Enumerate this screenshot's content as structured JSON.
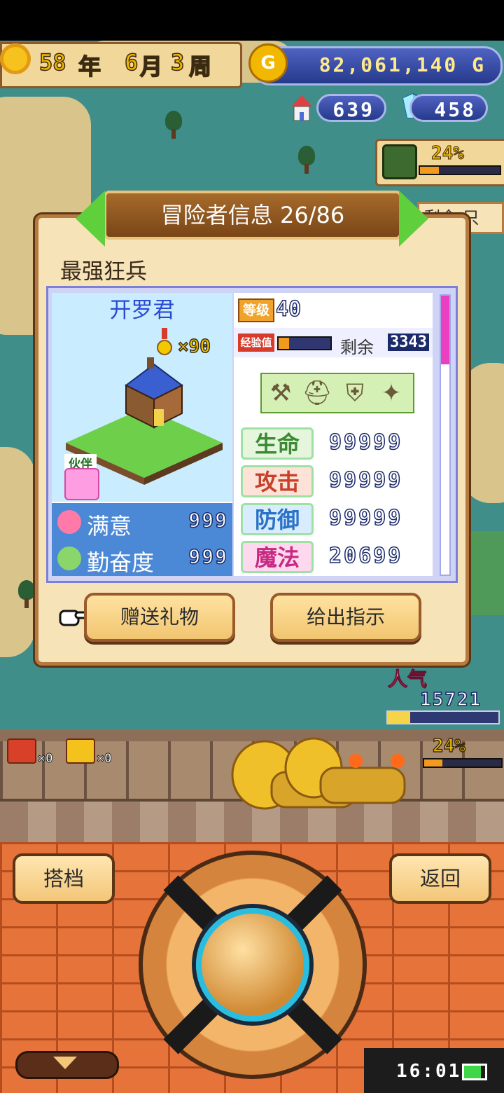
{
  "hud": {
    "year": "58",
    "year_unit": "年",
    "month": "6",
    "month_unit": "月",
    "week": "3",
    "week_unit": "周",
    "gold": "82,061,140",
    "gold_unit": "G",
    "coin_symbol": "G",
    "facility_count": "639",
    "crystal_count": "458",
    "cave_percent": "24%",
    "cave_progress": 0.24
  },
  "dialog": {
    "title": "冒险者信息 26/86",
    "class_name": "最强狂兵",
    "adventurer_name": "开罗君",
    "medal_count": "×90",
    "partner_tag": "伙伴",
    "level_label": "等级",
    "level": "40",
    "exp_label": "经验值",
    "exp_progress": 0.2,
    "remain_label": "剩余",
    "remain_value": "3343",
    "satisfaction_label": "满意",
    "satisfaction_value": "999",
    "diligence_label": "勤奋度",
    "diligence_value": "999",
    "stats": [
      {
        "name": "生命",
        "value": "99999",
        "color": "#3a8a34",
        "bg": "#e6f6dc"
      },
      {
        "name": "攻击",
        "value": "99999",
        "color": "#c8402a",
        "bg": "#fde2d8"
      },
      {
        "name": "防御",
        "value": "99999",
        "color": "#2a72c8",
        "bg": "#d8ecfd"
      },
      {
        "name": "魔法",
        "value": "20699",
        "color": "#c82a82",
        "bg": "#fdd8ef"
      }
    ],
    "gift_button": "赠送礼物",
    "instruct_button": "给出指示"
  },
  "side": {
    "partial_label": "剩余 只"
  },
  "popularity": {
    "label": "人气",
    "value": "15721",
    "progress": 0.2
  },
  "street": {
    "chest_red_count": "×0",
    "chest_gold_count": "×0",
    "percent": "24%",
    "progress": 0.24
  },
  "nav": {
    "partner_button": "搭档",
    "back_button": "返回"
  },
  "status": {
    "time": "16:01",
    "battery": 0.8
  }
}
